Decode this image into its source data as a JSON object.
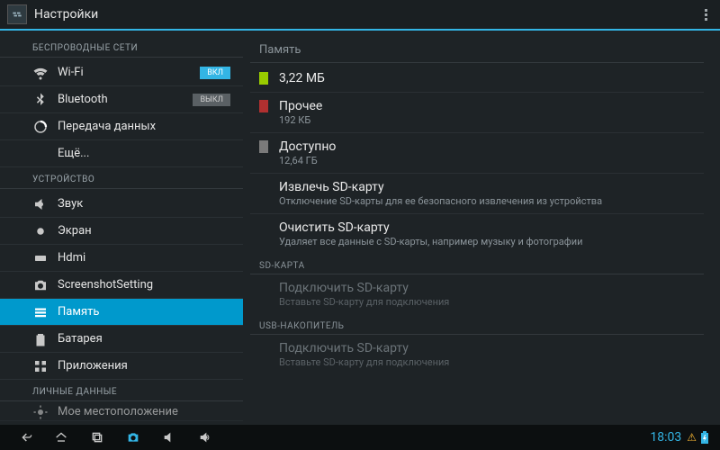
{
  "actionbar": {
    "title": "Настройки"
  },
  "left": {
    "cat_wireless": "БЕСПРОВОДНЫЕ СЕТИ",
    "cat_device": "УСТРОЙСТВО",
    "cat_personal": "ЛИЧНЫЕ ДАННЫЕ",
    "wifi": {
      "label": "Wi-Fi",
      "toggle": "ВКЛ"
    },
    "bt": {
      "label": "Bluetooth",
      "toggle": "ВЫКЛ"
    },
    "data_usage": {
      "label": "Передача данных"
    },
    "more": {
      "label": "Ещё..."
    },
    "sound": {
      "label": "Звук"
    },
    "display": {
      "label": "Экран"
    },
    "hdmi": {
      "label": "Hdmi"
    },
    "screenshot": {
      "label": "ScreenshotSetting"
    },
    "storage": {
      "label": "Память"
    },
    "battery": {
      "label": "Батарея"
    },
    "apps": {
      "label": "Приложения"
    },
    "location": {
      "label": "Мое местоположение"
    }
  },
  "right": {
    "header": "Память",
    "apps_size": "3,22 МБ",
    "other": {
      "title": "Прочее",
      "sub": "192 КБ"
    },
    "avail": {
      "title": "Доступно",
      "sub": "12,64 ГБ"
    },
    "eject": {
      "title": "Извлечь SD-карту",
      "sub": "Отключение SD-карты для ее безопасного извлечения из устройства"
    },
    "erase": {
      "title": "Очистить SD-карту",
      "sub": "Удаляет все данные с SD-карты, например музыку и фотографии"
    },
    "section_sd": "SD-КАРТА",
    "mount_sd": {
      "title": "Подключить SD-карту",
      "sub": "Вставьте SD-карту для подключения"
    },
    "section_usb": "USB-НАКОПИТЕЛЬ",
    "mount_usb": {
      "title": "Подключить SD-карту",
      "sub": "Вставьте SD-карту для подключения"
    }
  },
  "navbar": {
    "clock": "18:03"
  },
  "colors": {
    "accent": "#33b5e5"
  }
}
